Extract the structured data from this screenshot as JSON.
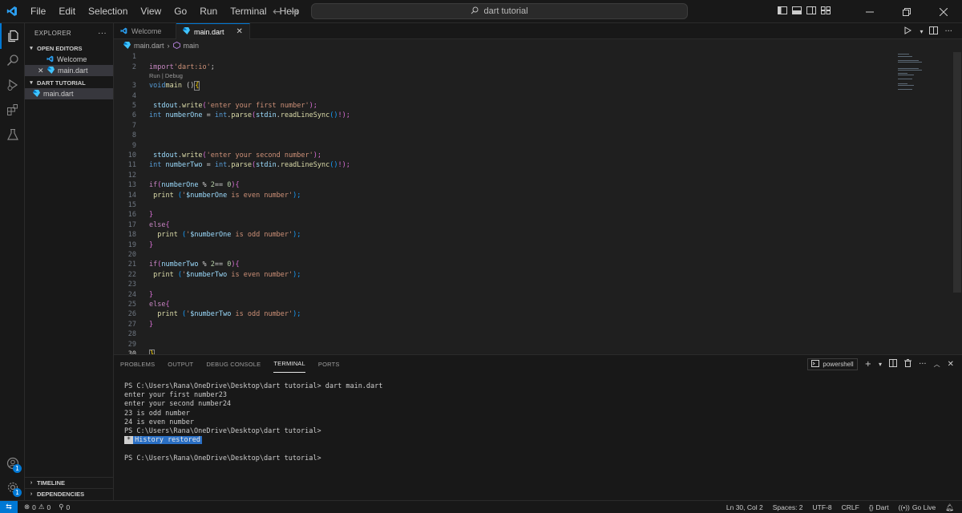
{
  "titlebar": {
    "menus": [
      "File",
      "Edit",
      "Selection",
      "View",
      "Go",
      "Run",
      "Terminal",
      "Help"
    ],
    "search_text": "dart tutorial"
  },
  "sidebar": {
    "title": "EXPLORER",
    "open_editors_label": "OPEN EDITORS",
    "open_editors": [
      {
        "label": "Welcome",
        "icon": "vscode-icon"
      },
      {
        "label": "main.dart",
        "icon": "dart-icon"
      }
    ],
    "project_label": "DART TUTORIAL",
    "files": [
      {
        "label": "main.dart"
      }
    ],
    "timeline_label": "TIMELINE",
    "dependencies_label": "DEPENDENCIES"
  },
  "tabs": [
    {
      "label": "Welcome"
    },
    {
      "label": "main.dart"
    }
  ],
  "breadcrumb": {
    "file": "main.dart",
    "symbol": "main"
  },
  "editor": {
    "codelens": "Run | Debug",
    "line_numbers": [
      "1",
      "2",
      "3",
      "4",
      "5",
      "6",
      "7",
      "8",
      "9",
      "10",
      "11",
      "12",
      "13",
      "14",
      "15",
      "16",
      "17",
      "18",
      "19",
      "20",
      "21",
      "22",
      "23",
      "24",
      "25",
      "26",
      "27",
      "28",
      "29",
      "30"
    ],
    "line1": "",
    "line2": {
      "kw": "import",
      "str": "'dart:io'",
      "end": ";"
    },
    "line3": {
      "type": "void",
      "fn": "main",
      "rest": " ()",
      "brace": "{"
    },
    "line5": {
      "obj": " stdout",
      "dot": ".",
      "fn": "write",
      "open": "(",
      "str": "'enter your first number'",
      "close": ");"
    },
    "line6": {
      "type": "int",
      "var": " numberOne",
      "eq": " = ",
      "cls": "int",
      "dot": ".",
      "fn": "parse",
      "open": "(",
      "obj": "stdin",
      "dot2": ".",
      "fn2": "readLineSync",
      "parens": "()",
      "close": "!);"
    },
    "line10": {
      "obj": " stdout",
      "dot": ".",
      "fn": "write",
      "open": "(",
      "str": "'enter your second number'",
      "close": ");"
    },
    "line11": {
      "type": "int",
      "var": " numberTwo",
      "eq": " = ",
      "cls": "int",
      "dot": ".",
      "fn": "parse",
      "open": "(",
      "obj": "stdin",
      "dot2": ".",
      "fn2": "readLineSync",
      "parens": "()",
      "close": "!);"
    },
    "line13": {
      "kw": "if",
      "open": "(",
      "var": "numberOne",
      "op": " % ",
      "num": "2",
      "op2": "== ",
      "num2": "0",
      "close": ")",
      "brace": "{"
    },
    "line14": {
      "fn": " print",
      "open": " (",
      "str1": "'",
      "interp": "$numberOne",
      "str2": " is even number'",
      "close": ");"
    },
    "line16": {
      "brace": "}"
    },
    "line17": {
      "kw": "else",
      "brace": "{"
    },
    "line18": {
      "fn": "  print",
      "open": " (",
      "str1": "'",
      "interp": "$numberOne",
      "str2": " is odd number'",
      "close": ");"
    },
    "line19": {
      "brace": "}"
    },
    "line21": {
      "kw": "if",
      "open": "(",
      "var": "numberTwo",
      "op": " % ",
      "num": "2",
      "op2": "== ",
      "num2": "0",
      "close": ")",
      "brace": "{"
    },
    "line22": {
      "fn": " print",
      "open": " (",
      "str1": "'",
      "interp": "$numberTwo",
      "str2": " is even number'",
      "close": ");"
    },
    "line24": {
      "brace": "}"
    },
    "line25": {
      "kw": "else",
      "brace": "{"
    },
    "line26": {
      "fn": "  print",
      "open": " (",
      "str1": "'",
      "interp": "$numberTwo",
      "str2": " is odd number'",
      "close": ");"
    },
    "line27": {
      "brace": "}"
    },
    "line30": {
      "brace": "}"
    }
  },
  "panel": {
    "tabs": [
      "PROBLEMS",
      "OUTPUT",
      "DEBUG CONSOLE",
      "TERMINAL",
      "PORTS"
    ],
    "active_tab": "TERMINAL",
    "shell": "powershell",
    "terminal_lines": [
      "PS C:\\Users\\Rana\\OneDrive\\Desktop\\dart tutorial> dart main.dart",
      "enter your first number23",
      "enter your second number24",
      "23 is odd number",
      "24 is even number",
      "PS C:\\Users\\Rana\\OneDrive\\Desktop\\dart tutorial>"
    ],
    "history_restored": "History restored",
    "history_marker": "*",
    "final_prompt": "PS C:\\Users\\Rana\\OneDrive\\Desktop\\dart tutorial>"
  },
  "statusbar": {
    "errors": "0",
    "warnings": "0",
    "ports": "0",
    "position": "Ln 30, Col 2",
    "spaces": "Spaces: 2",
    "encoding": "UTF-8",
    "eol": "CRLF",
    "language": "Dart",
    "live": "Go Live"
  },
  "colors": {
    "accent": "#0078d4",
    "keyword": "#c586c0",
    "type": "#569cd6",
    "function": "#dcdcaa",
    "variable": "#9cdcfe",
    "string": "#ce9178",
    "number": "#b5cea8"
  }
}
